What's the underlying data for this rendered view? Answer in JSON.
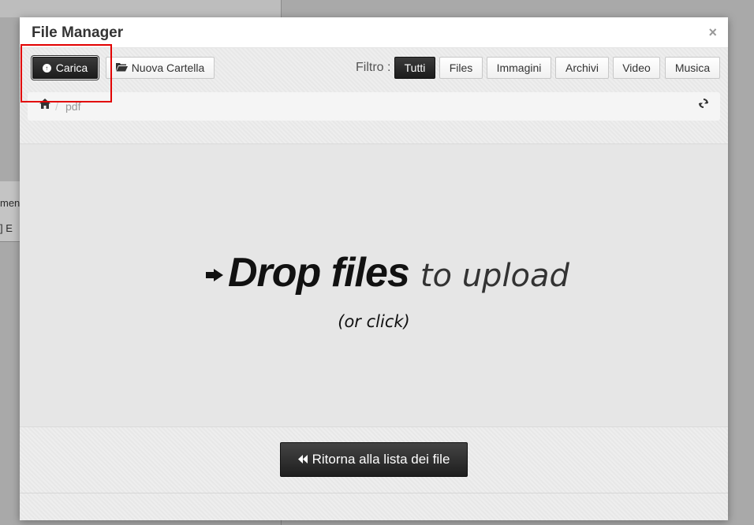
{
  "background": {
    "text_fragment_1": "men",
    "text_fragment_2": "] E"
  },
  "modal": {
    "title": "File Manager",
    "close_glyph": "×"
  },
  "toolbar": {
    "upload_label": "Carica",
    "new_folder_label": "Nuova Cartella",
    "filter_label": "Filtro :",
    "filters": [
      "Tutti",
      "Files",
      "Immagini",
      "Archivi",
      "Video",
      "Musica"
    ],
    "active_filter": "Tutti"
  },
  "breadcrumb": {
    "separator": "/",
    "current": "pdf"
  },
  "dropzone": {
    "strong_text": "Drop files",
    "rest_text": "to upload",
    "sub_text": "(or click)"
  },
  "footer": {
    "back_label": "Ritorna alla lista dei file"
  },
  "icons": {
    "upload": "circle-arrow-up-icon",
    "folder": "folder-open-icon",
    "home": "home-icon",
    "refresh": "refresh-icon",
    "drop_arrow": "hand-right-icon",
    "back": "fast-backward-icon",
    "close": "close-icon"
  },
  "colors": {
    "highlight": "#e20000",
    "dark_button": "#222222"
  }
}
